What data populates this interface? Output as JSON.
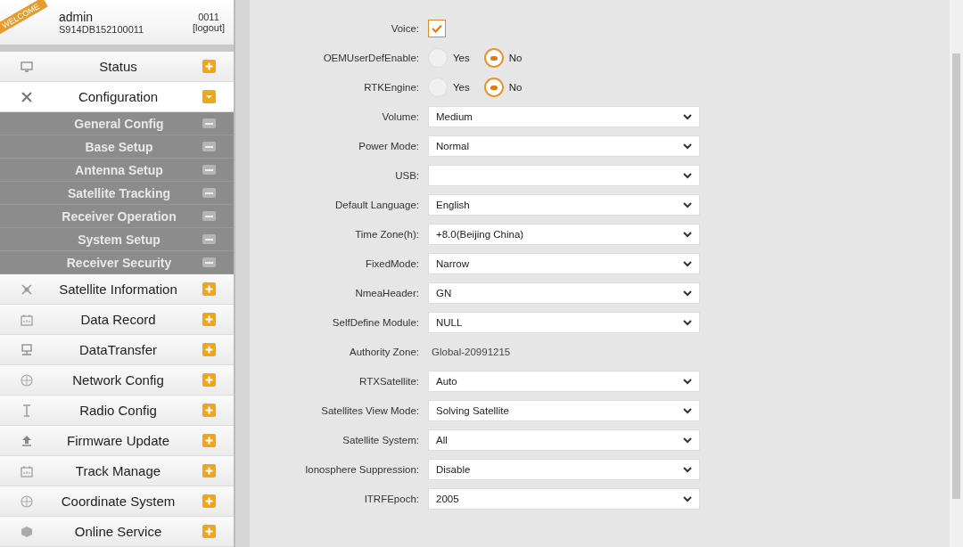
{
  "user": {
    "badge": "WELCOME",
    "name": "admin",
    "serial": "S914DB152100011",
    "code": "0011",
    "logout": "[logout]"
  },
  "menu": [
    {
      "label": "Status",
      "expanded": false
    },
    {
      "label": "Configuration",
      "expanded": true,
      "children": [
        {
          "label": "General Config"
        },
        {
          "label": "Base Setup"
        },
        {
          "label": "Antenna Setup"
        },
        {
          "label": "Satellite Tracking"
        },
        {
          "label": "Receiver Operation"
        },
        {
          "label": "System Setup"
        },
        {
          "label": "Receiver Security"
        }
      ]
    },
    {
      "label": "Satellite Information",
      "expanded": false
    },
    {
      "label": "Data Record",
      "expanded": false
    },
    {
      "label": "DataTransfer",
      "expanded": false
    },
    {
      "label": "Network Config",
      "expanded": false
    },
    {
      "label": "Radio Config",
      "expanded": false
    },
    {
      "label": "Firmware Update",
      "expanded": false
    },
    {
      "label": "Track Manage",
      "expanded": false
    },
    {
      "label": "Coordinate System",
      "expanded": false
    },
    {
      "label": "Online Service",
      "expanded": false
    }
  ],
  "form": [
    {
      "kind": "checkbox",
      "label": "Voice:",
      "checked": true
    },
    {
      "kind": "radio",
      "label": "OEMUserDefEnable:",
      "options": [
        {
          "label": "Yes",
          "selected": false
        },
        {
          "label": "No",
          "selected": true
        }
      ]
    },
    {
      "kind": "radio",
      "label": "RTKEngine:",
      "options": [
        {
          "label": "Yes",
          "selected": false
        },
        {
          "label": "No",
          "selected": true
        }
      ]
    },
    {
      "kind": "select",
      "label": "Volume:",
      "value": "Medium"
    },
    {
      "kind": "select",
      "label": "Power Mode:",
      "value": "Normal"
    },
    {
      "kind": "select",
      "label": "USB:"
    },
    {
      "kind": "select",
      "label": "Default Language:",
      "value": "English"
    },
    {
      "kind": "select",
      "label": "Time Zone(h):",
      "value": "+8.0(Beijing China)"
    },
    {
      "kind": "select",
      "label": "FixedMode:",
      "value": "Narrow"
    },
    {
      "kind": "select",
      "label": "NmeaHeader:",
      "value": "GN"
    },
    {
      "kind": "select",
      "label": "SelfDefine Module:",
      "value": "NULL"
    },
    {
      "kind": "text",
      "label": "Authority Zone:",
      "value": "Global-20991215"
    },
    {
      "kind": "select",
      "label": "RTXSatellite:",
      "value": "Auto"
    },
    {
      "kind": "select",
      "label": "Satellites View Mode:",
      "value": "Solving Satellite"
    },
    {
      "kind": "select",
      "label": "Satellite System:",
      "value": "All"
    },
    {
      "kind": "select",
      "label": "Ionosphere Suppression:",
      "value": "Disable"
    },
    {
      "kind": "select",
      "label": "ITRFEpoch:",
      "value": "2005"
    }
  ]
}
